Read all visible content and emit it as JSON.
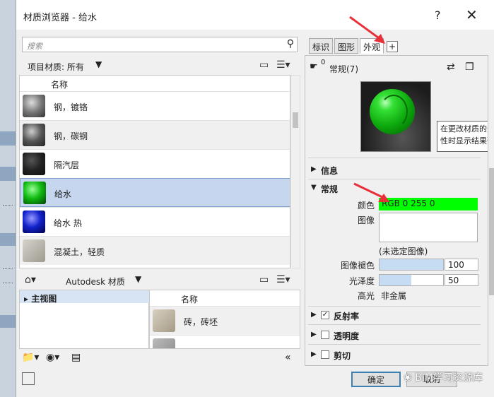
{
  "window": {
    "title": "材质浏览器 - 给水",
    "help": "?",
    "close": "✕"
  },
  "search": {
    "placeholder": "搜索"
  },
  "project": {
    "filter_label": "项目材质: 所有",
    "column_name": "名称",
    "materials": [
      {
        "name": "钢，镀铬",
        "color": "#8a8a8a"
      },
      {
        "name": "钢，碳钢",
        "color": "#6f6f6f"
      },
      {
        "name": "隔汽层",
        "color": "#2a2a2a"
      },
      {
        "name": "给水",
        "color": "#12b012",
        "selected": true
      },
      {
        "name": "给水 热",
        "color": "#1020c0"
      },
      {
        "name": "混凝土，轻质",
        "color": "#b0ada6"
      }
    ]
  },
  "library": {
    "breadcrumb": "Autodesk 材质",
    "tree_root": "主视图",
    "column_name": "名称",
    "items": [
      {
        "name": "砖，砖坯",
        "color": "#c0b8a8"
      }
    ]
  },
  "tabs": [
    {
      "label": "标识"
    },
    {
      "label": "图形"
    },
    {
      "label": "外观",
      "active": true
    }
  ],
  "tab_add": "+",
  "appearance": {
    "asset_count": "0",
    "asset_name": "常规(7)",
    "tooltip_lines": [
      "在更改材质的外",
      "性时显示结果预"
    ],
    "sections": {
      "info": "信息",
      "generic": "常规",
      "reflectivity": "反射率",
      "transparency": "透明度",
      "cutout": "剪切"
    },
    "props": {
      "color_label": "颜色",
      "color_value": "RGB 0 255 0",
      "image_label": "图像",
      "image_none": "(未选定图像)",
      "fade_label": "图像褪色",
      "fade_value": "100",
      "fade_fraction": 1.0,
      "gloss_label": "光泽度",
      "gloss_value": "50",
      "gloss_fraction": 0.5,
      "highlight_label": "高光",
      "highlight_value": "非金属"
    },
    "reflectivity_checked": true
  },
  "buttons": {
    "ok": "确定",
    "cancel": "取消"
  },
  "watermark": "BIM学习资源库",
  "colors": {
    "accent_green": "#00ff00",
    "selection": "#c5d6ee",
    "arrow": "#e8303a"
  }
}
